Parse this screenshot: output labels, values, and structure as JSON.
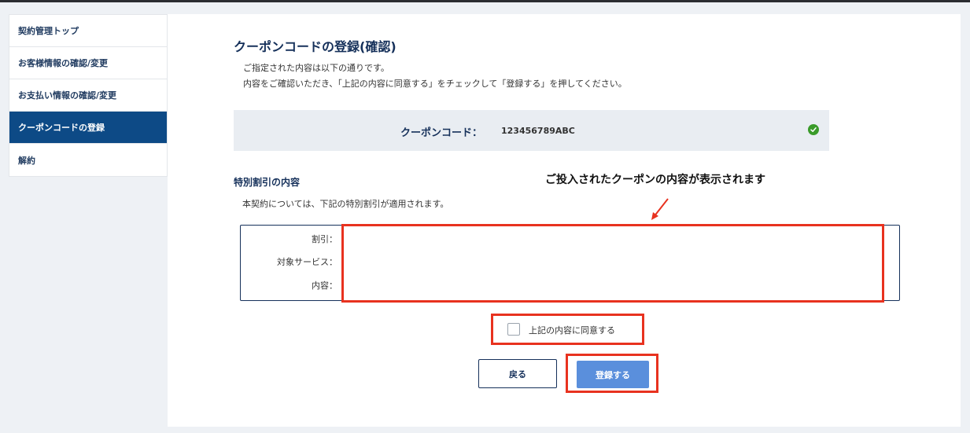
{
  "sidebar": {
    "items": [
      {
        "label": "契約管理トップ"
      },
      {
        "label": "お客様情報の確認/変更"
      },
      {
        "label": "お支払い情報の確認/変更"
      },
      {
        "label": "クーポンコードの登録",
        "active": true
      },
      {
        "label": "解約"
      }
    ]
  },
  "main": {
    "title": "クーポンコードの登録(確認)",
    "desc_line1": "ご指定された内容は以下の通りです。",
    "desc_line2": "内容をご確認いただき、「上記の内容に同意する」をチェックして「登録する」を押してください。",
    "coupon": {
      "label": "クーポンコード：",
      "value": "123456789ABC",
      "status_icon": "check-circle-icon"
    },
    "discount": {
      "section_title": "特別割引の内容",
      "section_desc": "本契約については、下記の特別割引が適用されます。",
      "fields": [
        {
          "label": "割引："
        },
        {
          "label": "対象サービス："
        },
        {
          "label": "内容："
        }
      ]
    },
    "annotation": "ご投入されたクーポンの内容が表示されます",
    "agree_label": "上記の内容に同意する",
    "back_label": "戻る",
    "submit_label": "登録する"
  },
  "colors": {
    "primary_navy": "#15305a",
    "sidebar_active": "#0d4a86",
    "submit_blue": "#5a8fdc",
    "highlight_red": "#e8321f",
    "check_green": "#3a9b2a"
  }
}
